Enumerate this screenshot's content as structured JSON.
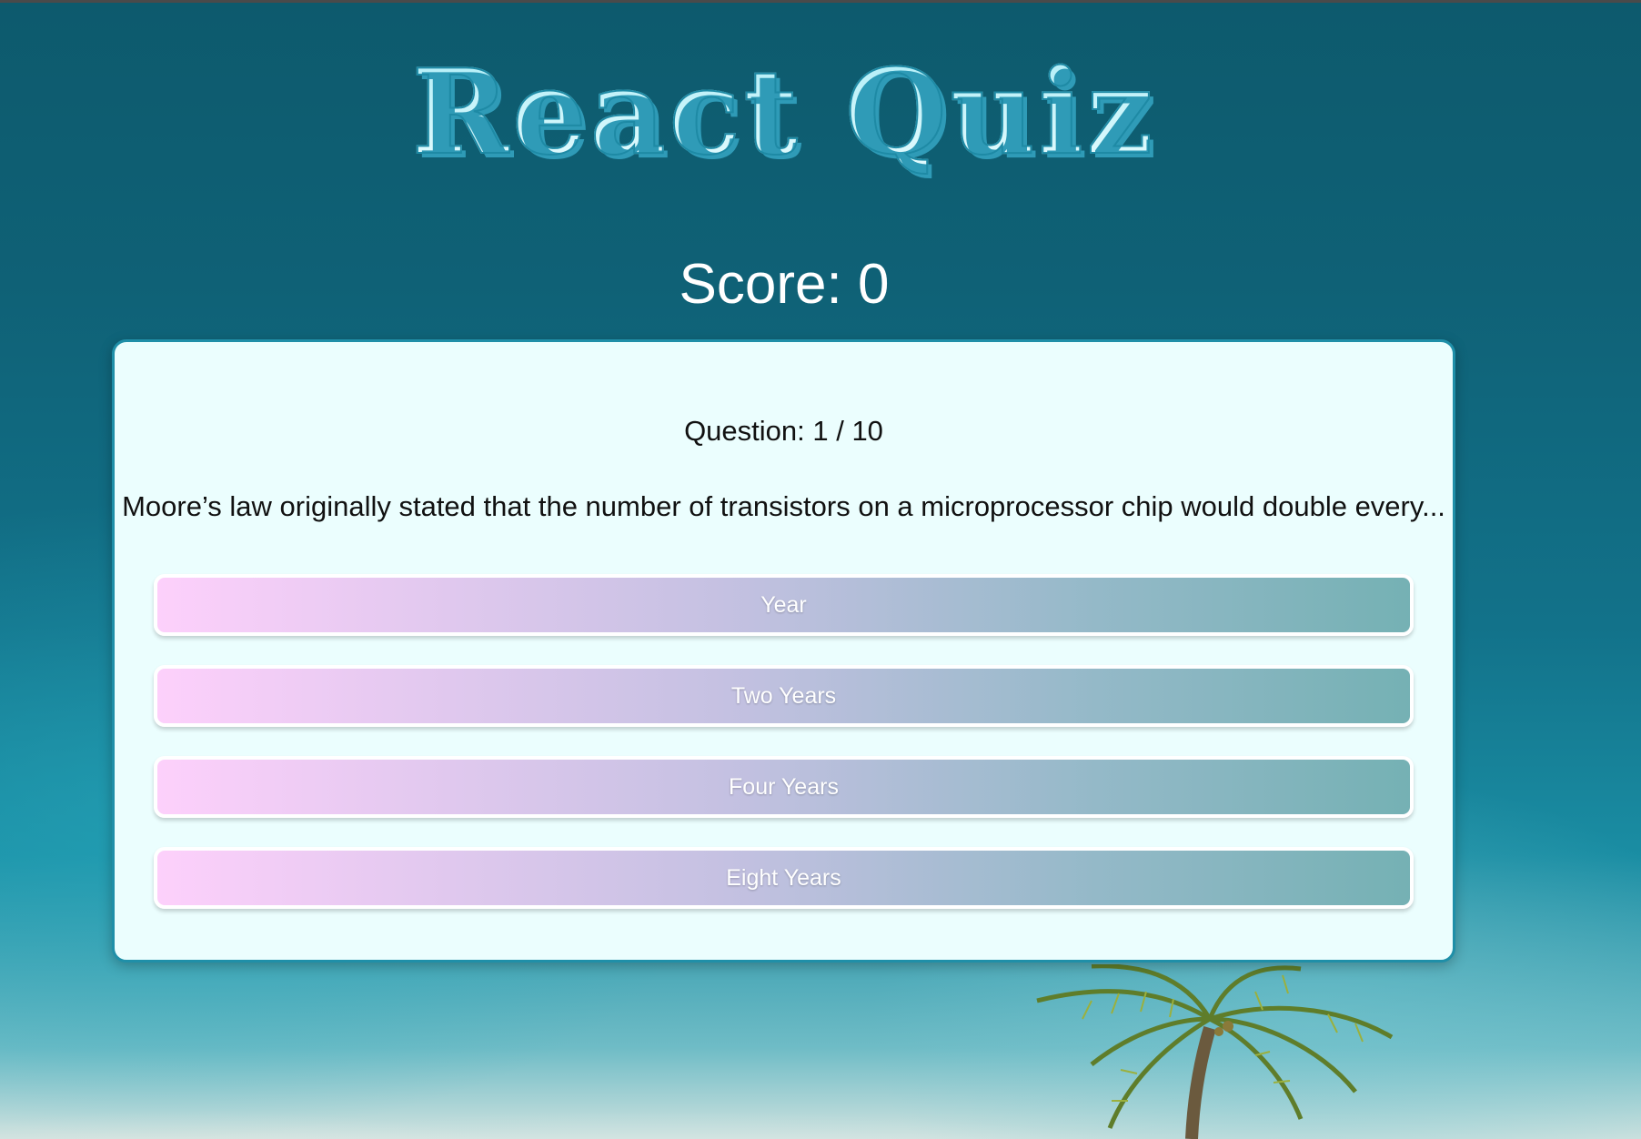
{
  "app": {
    "title": "React Quiz"
  },
  "score": {
    "label": "Score: 0"
  },
  "question": {
    "counter": "Question: 1 / 10",
    "text": "Moore’s law originally stated that the number of transistors on a microprocessor chip would double every..."
  },
  "answers": [
    {
      "label": "Year"
    },
    {
      "label": "Two Years"
    },
    {
      "label": "Four Years"
    },
    {
      "label": "Eight Years"
    }
  ],
  "colors": {
    "card_background": "#ebfefe",
    "card_border": "#1f8fa8",
    "answer_gradient_start": "#fdd0fb",
    "answer_gradient_end": "#75b1b4",
    "title_fill": "#c9f6fb"
  },
  "background": {
    "description_icon": "ocean-beach-background"
  }
}
